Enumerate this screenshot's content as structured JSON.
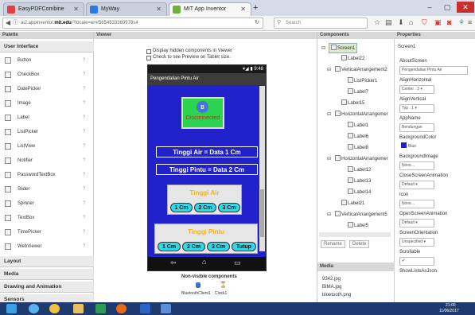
{
  "browser": {
    "tabs": [
      {
        "label": "EasyPDFCombine",
        "color": "#e04040"
      },
      {
        "label": "MyWay",
        "color": "#2a7adf"
      },
      {
        "label": "MIT App Inventor",
        "color": "#6cb33e"
      }
    ],
    "new_tab": "+",
    "window_controls": [
      "–",
      "▢",
      "✕"
    ],
    "url_prefix": "ai2.appinventor.",
    "url_domain": "mit.edu",
    "url_suffix": "/?locale=en#5654533369978s4",
    "search_placeholder": "Search"
  },
  "palette": {
    "header": "Palette",
    "user_interface": "User Interface",
    "items": [
      "Button",
      "CheckBox",
      "DatePicker",
      "Image",
      "Label",
      "ListPicker",
      "ListView",
      "Notifier",
      "PasswordTextBox",
      "Slider",
      "Spinner",
      "TextBox",
      "TimePicker",
      "WebViewer"
    ],
    "help_glyph": "?",
    "categories": [
      "Layout",
      "Media",
      "Drawing and Animation",
      "Sensors"
    ]
  },
  "viewer": {
    "header": "Viewer",
    "display_hidden": "Display hidden components in Viewer",
    "preview_tablet": "Check to see Preview on Tablet size.",
    "status_time": "9:48",
    "app_title": "Pengendalian Pintu Air",
    "bt_symbol": "ʙ",
    "disconnected": "Disconnected",
    "tinggi_air": "Tinggi Air =  Data 1  Cm",
    "tinggi_pintu": "Tinggi Pintu =  Data 2  Cm",
    "group_air_label": "Tinggi Air",
    "group_air_buttons": [
      "1 Cm",
      "2 Cm",
      "3 Cm"
    ],
    "group_pintu_label": "Tinggi Pintu",
    "group_pintu_buttons": [
      "1 Cm",
      "2 Cm",
      "3 Cm",
      "Tutup"
    ],
    "nav_back": "⇦",
    "nav_home": "⌂",
    "nav_recent": "▭",
    "nonvisible_title": "Non-visible components",
    "nonvisible_items": [
      "BluetoothClient1",
      "Clock1"
    ]
  },
  "components": {
    "header": "Components",
    "tree": [
      {
        "label": "Screen1",
        "indent": 0,
        "expander": "⊟",
        "selected": true
      },
      {
        "label": "Label22",
        "indent": 2
      },
      {
        "label": "VerticalArrangement2",
        "indent": 1,
        "expander": "⊟"
      },
      {
        "label": "ListPicker1",
        "indent": 3
      },
      {
        "label": "Label7",
        "indent": 3
      },
      {
        "label": "Label15",
        "indent": 2
      },
      {
        "label": "HorizontalArrangemer",
        "indent": 1,
        "expander": "⊟"
      },
      {
        "label": "Label1",
        "indent": 3
      },
      {
        "label": "Label6",
        "indent": 3
      },
      {
        "label": "Label8",
        "indent": 3
      },
      {
        "label": "HorizontalArrangemer",
        "indent": 1,
        "expander": "⊟"
      },
      {
        "label": "Label12",
        "indent": 3
      },
      {
        "label": "Label13",
        "indent": 3
      },
      {
        "label": "Label14",
        "indent": 3
      },
      {
        "label": "Label21",
        "indent": 2
      },
      {
        "label": "VerticalArrangement5",
        "indent": 1,
        "expander": "⊟"
      },
      {
        "label": "Label5",
        "indent": 3
      }
    ],
    "rename": "Rename",
    "delete": "Delete",
    "media_header": "Media",
    "media_items": [
      "9342.jpg",
      "BIMA.jpg",
      "bluetooth.png"
    ]
  },
  "properties": {
    "header": "Properties",
    "screen": "Screen1",
    "rows": [
      {
        "label": "AboutScreen",
        "value": "Pengendalian Pintu Air"
      },
      {
        "label": "AlignHorizontal",
        "value": "Center : 3 ▾"
      },
      {
        "label": "AlignVertical",
        "value": "Top : 1 ▾"
      },
      {
        "label": "AppName",
        "value": "Bendungan"
      },
      {
        "label": "BackgroundColor",
        "value": "Blue"
      },
      {
        "label": "BackgroundImage",
        "value": "None..."
      },
      {
        "label": "CloseScreenAnimation",
        "value": "Default ▾"
      },
      {
        "label": "Icon",
        "value": "None..."
      },
      {
        "label": "OpenScreenAnimation",
        "value": "Default ▾"
      },
      {
        "label": "ScreenOrientation",
        "value": "Unspecified ▾"
      },
      {
        "label": "Scrollable",
        "value": "✔"
      },
      {
        "label": "ShowListsAsJson",
        "value": ""
      }
    ],
    "bg_color": "#2222cc"
  },
  "taskbar": {
    "time": "21:00",
    "date": "11/06/2017"
  }
}
